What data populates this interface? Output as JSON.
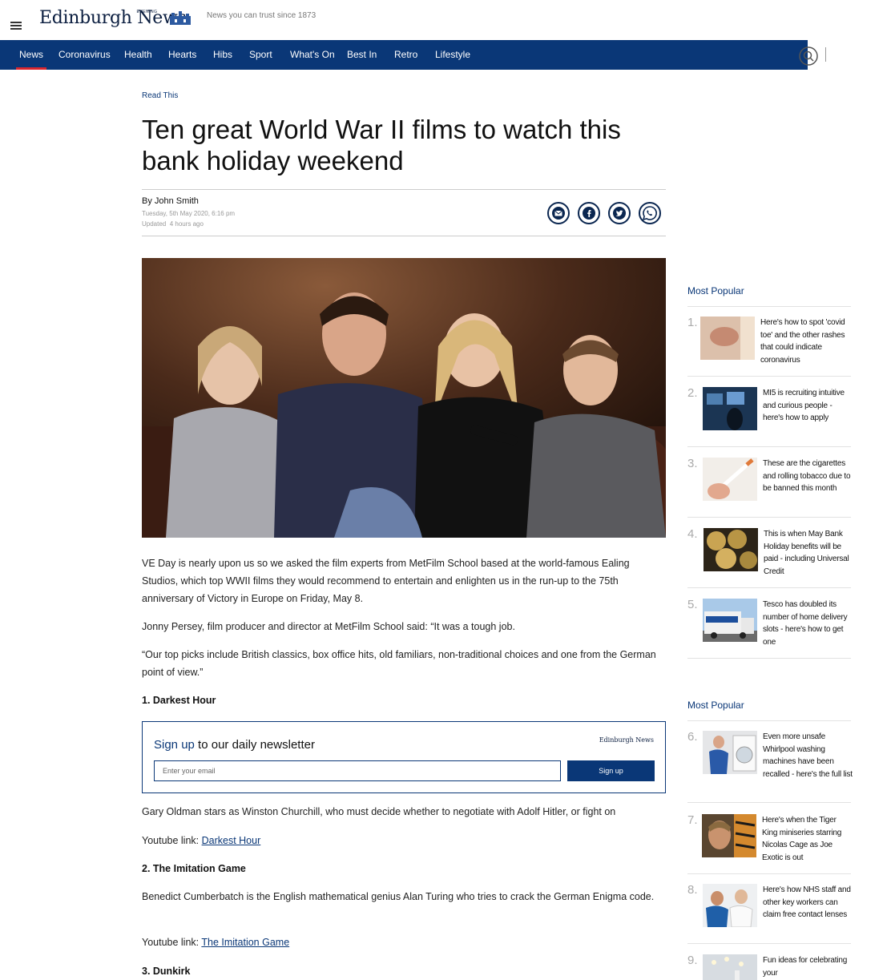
{
  "header": {
    "logo_text": "Edinburgh News",
    "logo_evening": "EVENING",
    "tagline": "News you can trust since 1873"
  },
  "nav": {
    "items": [
      {
        "label": "News",
        "active": true
      },
      {
        "label": "Coronavirus"
      },
      {
        "label": "Health"
      },
      {
        "label": "Hearts"
      },
      {
        "label": "Hibs"
      },
      {
        "label": "Sport"
      },
      {
        "label": "What's On"
      },
      {
        "label": "Best In"
      },
      {
        "label": "Retro"
      },
      {
        "label": "Lifestyle"
      }
    ],
    "accent": "#0a3777",
    "active_underline": "#d9262e"
  },
  "article": {
    "kicker": "Read This",
    "headline": "Ten great World War II films to watch this bank holiday weekend",
    "author": "By John Smith",
    "published": "Tuesday, 5th May 2020, 6:16 pm",
    "updated_label": "Updated",
    "updated_value": "4 hours ago",
    "share_icons": [
      "email-icon",
      "facebook-icon",
      "twitter-icon",
      "whatsapp-icon"
    ],
    "paragraphs": [
      "VE Day is nearly upon us so we asked the film experts from MetFilm School based at the world-famous Ealing Studios, which top WWII films they would recommend to entertain and enlighten us in the run-up to the 75th anniversary of Victory in Europe on Friday, May 8.",
      "Jonny Persey, film producer and director at MetFilm School said: “It was a tough job.",
      "“Our top picks include British classics, box office hits, old familiars, non-traditional choices and one from the German point of view.”"
    ],
    "films": [
      {
        "heading": "1. Darkest Hour",
        "description": "Gary Oldman stars as Winston Churchill, who must decide whether to negotiate with Adolf Hitler, or fight on",
        "link_prefix": "Youtube link:",
        "link_text": "Darkest Hour"
      },
      {
        "heading": "2. The Imitation Game",
        "description": "Benedict Cumberbatch is the English mathematical genius Alan Turing who tries to crack the German Enigma code.",
        "link_prefix": "Youtube link:",
        "link_text": "The Imitation Game"
      },
      {
        "heading": "3. Dunkirk"
      }
    ]
  },
  "newsletter": {
    "title_highlight": "Sign up",
    "title_rest": "to our daily newsletter",
    "logo_text": "Edinburgh News",
    "email_placeholder": "Enter your email",
    "button_label": "Sign up"
  },
  "sidebar": {
    "heading_1": "Most Popular",
    "heading_2": "Most Popular",
    "items": [
      {
        "num": "1.",
        "title": "Here's how to spot 'covid toe' and the other rashes that could indicate coronavirus"
      },
      {
        "num": "2.",
        "title": "MI5 is recruiting intuitive and curious people - here's how to apply"
      },
      {
        "num": "3.",
        "title": "These are the cigarettes and rolling tobacco due to be banned this month"
      },
      {
        "num": "4.",
        "title": "This is when May Bank Holiday benefits will be paid - including Universal Credit"
      },
      {
        "num": "5.",
        "title": "Tesco has doubled its number of home delivery slots - here's how to get one"
      },
      {
        "num": "6.",
        "title": "Even more unsafe Whirlpool washing machines have been recalled - here's the full list"
      },
      {
        "num": "7.",
        "title": "Here's when the Tiger King miniseries starring Nicolas Cage as Joe Exotic is out"
      },
      {
        "num": "8.",
        "title": "Here's how NHS staff and other key workers can claim free contact lenses"
      },
      {
        "num": "9.",
        "title": "Fun ideas for celebrating your"
      }
    ]
  }
}
